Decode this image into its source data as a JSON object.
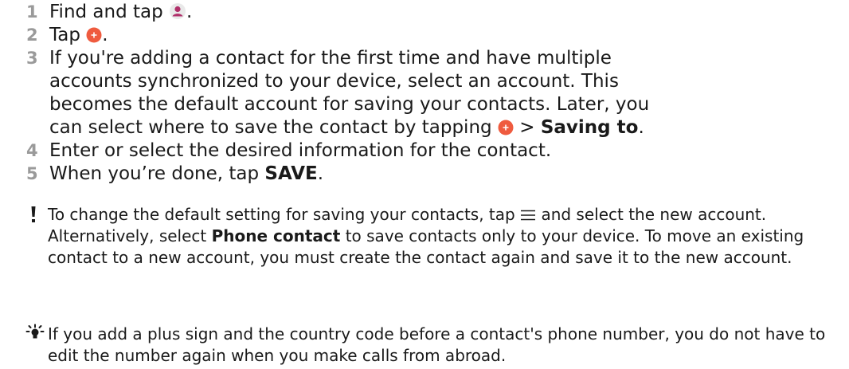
{
  "steps": [
    {
      "number": "1",
      "before": "Find and tap",
      "after": ".",
      "icon": "contacts-app-icon"
    },
    {
      "number": "2",
      "before": "Tap",
      "after": ".",
      "icon": "add-contact-fab-icon"
    },
    {
      "number": "3",
      "text": "If you're adding a contact for the first time and have multiple accounts synchronized to your device, select an account. This becomes the default account for saving your contacts. Later, you can select where to save the contact by tapping",
      "mid": " > ",
      "bold": "Saving to",
      "after": ".",
      "icon": "add-contact-fab-icon"
    },
    {
      "number": "4",
      "text": "Enter or select the desired information for the contact."
    },
    {
      "number": "5",
      "before": "When you’re done, tap ",
      "bold": "SAVE",
      "after": "."
    }
  ],
  "note_warning": {
    "icon": "exclamation-icon",
    "part1": "To change the default setting for saving your contacts, tap",
    "menu_icon": "menu-icon",
    "part2": " and select the new account. Alternatively, select ",
    "bold": "Phone contact",
    "part3": " to save contacts only to your device. To move an existing contact to a new account, you must create the contact again and save it to the new account."
  },
  "note_tip": {
    "icon": "lightbulb-icon",
    "text": "If you add a plus sign and the country code before a contact's phone number, you do not have to edit the number again when you make calls from abroad."
  },
  "colors": {
    "step_number": "#9a9a9a",
    "fab": "#ef5b3f",
    "contacts_icon": "#b0306a"
  }
}
